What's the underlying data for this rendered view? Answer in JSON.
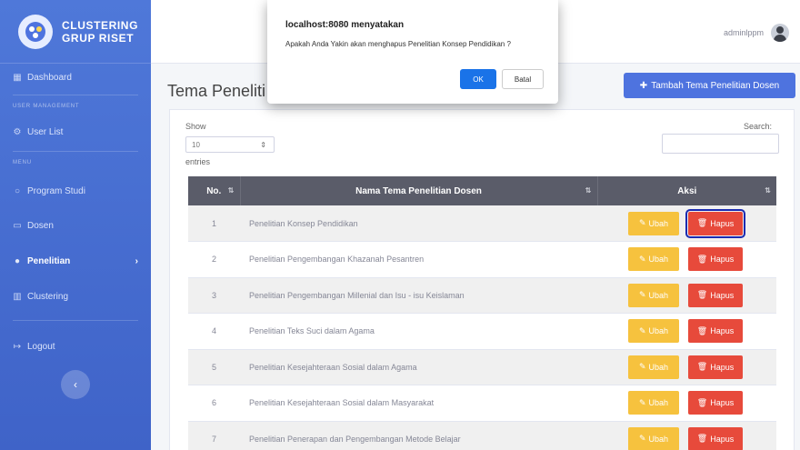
{
  "brand": {
    "line1": "CLUSTERING",
    "line2": "GRUP RISET"
  },
  "sidebar": {
    "dashboard": "Dashboard",
    "heading_user": "USER MANAGEMENT",
    "user_list": "User List",
    "heading_menu": "MENU",
    "program_studi": "Program Studi",
    "dosen": "Dosen",
    "penelitian": "Penelitian",
    "clustering": "Clustering",
    "logout": "Logout"
  },
  "topbar": {
    "username": "adminlppm"
  },
  "page": {
    "title": "Tema Peneliti",
    "add_button": "Tambah Tema Penelitian Dosen"
  },
  "table_controls": {
    "show": "Show",
    "length_value": "10",
    "entries": "entries",
    "search": "Search:"
  },
  "table": {
    "headers": [
      "No.",
      "Nama Tema Penelitian Dosen",
      "Aksi"
    ],
    "edit_label": "Ubah",
    "delete_label": "Hapus",
    "rows": [
      {
        "no": "1",
        "name": "Penelitian Konsep Pendidikan"
      },
      {
        "no": "2",
        "name": "Penelitian Pengembangan Khazanah Pesantren"
      },
      {
        "no": "3",
        "name": "Penelitian Pengembangan Millenial dan Isu - isu Keislaman"
      },
      {
        "no": "4",
        "name": "Penelitian Teks Suci dalam Agama"
      },
      {
        "no": "5",
        "name": "Penelitian Kesejahteraan Sosial dalam Agama"
      },
      {
        "no": "6",
        "name": "Penelitian Kesejahteraan Sosial dalam Masyarakat"
      },
      {
        "no": "7",
        "name": "Penelitian Penerapan dan Pengembangan Metode Belajar"
      }
    ]
  },
  "dialog": {
    "title": "localhost:8080 menyatakan",
    "message": "Apakah Anda Yakin akan menghapus Penelitian Konsep Pendidikan ?",
    "ok": "OK",
    "cancel": "Batal"
  },
  "colors": {
    "sidebar": "#4e73df",
    "header": "#5a5c69",
    "edit": "#f6c23e",
    "delete": "#e74a3b",
    "primary": "#4e73df"
  }
}
